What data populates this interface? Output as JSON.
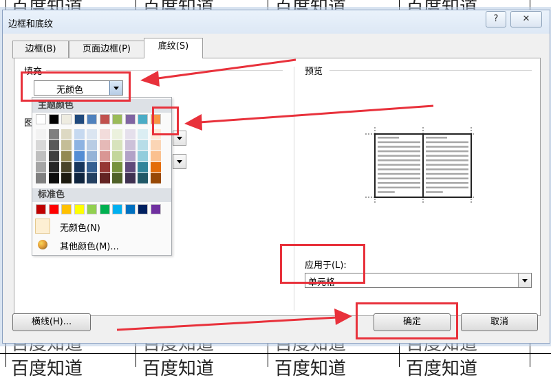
{
  "background_document": {
    "cell_text": "百度知道"
  },
  "dialog": {
    "title": "边框和底纹",
    "help_button": "?",
    "close_button": "✕",
    "tabs": [
      {
        "label": "边框(B)",
        "active": false
      },
      {
        "label": "页面边框(P)",
        "active": false
      },
      {
        "label": "底纹(S)",
        "active": true
      }
    ],
    "fill": {
      "group_label": "填充",
      "value": "无颜色"
    },
    "pattern": {
      "group_label": "图"
    },
    "preview": {
      "group_label": "预览"
    },
    "apply_to": {
      "label": "应用于(L):",
      "value": "单元格"
    },
    "buttons": {
      "horizontal_line": "横线(H)...",
      "ok": "确定",
      "cancel": "取消"
    }
  },
  "color_popup": {
    "theme_header": "主题颜色",
    "standard_header": "标准色",
    "no_color_label": "无颜色(N)",
    "more_colors_label": "其他颜色(M)...",
    "theme_top_row": [
      "#ffffff",
      "#000000",
      "#eeece1",
      "#1f497d",
      "#4f81bd",
      "#c0504d",
      "#9bbb59",
      "#8064a2",
      "#4bacc6",
      "#f79646"
    ],
    "theme_shades": [
      [
        "#f2f2f2",
        "#7f7f7f",
        "#ddd9c3",
        "#c6d9f0",
        "#dbe5f1",
        "#f2dcdb",
        "#ebf1dd",
        "#e5e0ec",
        "#dbeef3",
        "#fdeada"
      ],
      [
        "#d8d8d8",
        "#595959",
        "#c4bd97",
        "#8db3e2",
        "#b8cce4",
        "#e5b9b7",
        "#d7e3bc",
        "#ccc1d9",
        "#b7dde8",
        "#fbd5b5"
      ],
      [
        "#bfbfbf",
        "#3f3f3f",
        "#938953",
        "#548dd4",
        "#95b3d7",
        "#d99694",
        "#c3d69b",
        "#b2a2c7",
        "#92cddc",
        "#fac08f"
      ],
      [
        "#a5a5a5",
        "#262626",
        "#494429",
        "#17365d",
        "#366092",
        "#953734",
        "#76923c",
        "#5f497a",
        "#31859b",
        "#e36c09"
      ],
      [
        "#7f7f7f",
        "#0c0c0c",
        "#1d1b10",
        "#0f243e",
        "#244061",
        "#632423",
        "#4f6128",
        "#3f3151",
        "#205867",
        "#974806"
      ]
    ],
    "standard_colors": [
      "#c00000",
      "#ff0000",
      "#ffc000",
      "#ffff00",
      "#92d050",
      "#00b050",
      "#00b0f0",
      "#0070c0",
      "#002060",
      "#7030a0"
    ],
    "highlighted_color": "#f79646"
  },
  "annotation_color": "#e8313b"
}
